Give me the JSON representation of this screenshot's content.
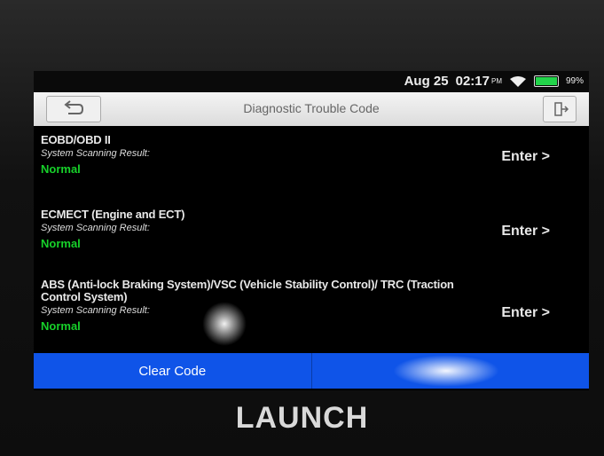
{
  "status": {
    "date": "Aug 25",
    "time": "02:17",
    "ampm": "PM",
    "battery": "99%",
    "battery_level": 0.99,
    "battery_color": "#22d44a"
  },
  "titlebar": {
    "title": "Diagnostic Trouble Code",
    "back_icon": "back-arrow-icon",
    "exit_icon": "exit-icon"
  },
  "systems": [
    {
      "name": "EOBD/OBD II",
      "label": "System Scanning Result:",
      "status": "Normal",
      "action": "Enter >"
    },
    {
      "name": "ECMECT (Engine and ECT)",
      "label": "System Scanning Result:",
      "status": "Normal",
      "action": "Enter >"
    },
    {
      "name": "ABS (Anti-lock Braking System)/VSC (Vehicle Stability Control)/ TRC (Traction Control System)",
      "label": "System Scanning Result:",
      "status": "Normal",
      "action": "Enter >"
    }
  ],
  "bottom": {
    "clear_code": "Clear Code",
    "second_button": ""
  },
  "colors": {
    "accent": "#0f54e8",
    "normal_status": "#17d12a"
  },
  "brand": "LAUNCH"
}
